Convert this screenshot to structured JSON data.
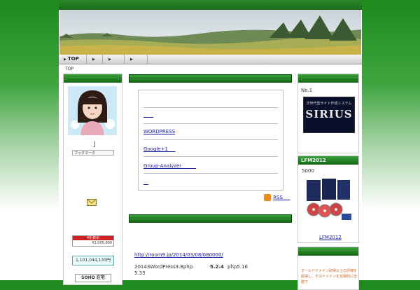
{
  "nav": {
    "items": [
      {
        "label": "TOP"
      },
      {
        "label": ""
      },
      {
        "label": ""
      },
      {
        "label": ""
      }
    ]
  },
  "breadcrumb": "TOP",
  "left": {
    "char_line": "亅",
    "bookmark_label": "ブックマーク",
    "counter1": "4桁表示",
    "counter1_value": "¥1,005,600",
    "counter2": "1,101,044,130円",
    "soho": "SOHO 在宅"
  },
  "center": {
    "links": [
      "____",
      "WORDPRESS",
      "Google+1　_",
      "Group-Analyzer　　　",
      "__"
    ],
    "rss": "RSS　_",
    "post_url": "http://room9.jp/2014/03/08/080000/",
    "post_text1": "20143WordPress3.8php",
    "post_bold": "5.2.4",
    "post_text2": "php5.16",
    "post_text3": "5.33"
  },
  "right": {
    "rank": "No.1",
    "sirius_sub": "次世代型サイト作成システム",
    "sirius_title": "SIRIUS",
    "lfm_head": "LFM2012",
    "lfm_price": "5000",
    "lfm_link": "LFM2012",
    "promo": "オールドドメイン取得以上の評価を取得し、そのドメインを定期的に自動で"
  }
}
